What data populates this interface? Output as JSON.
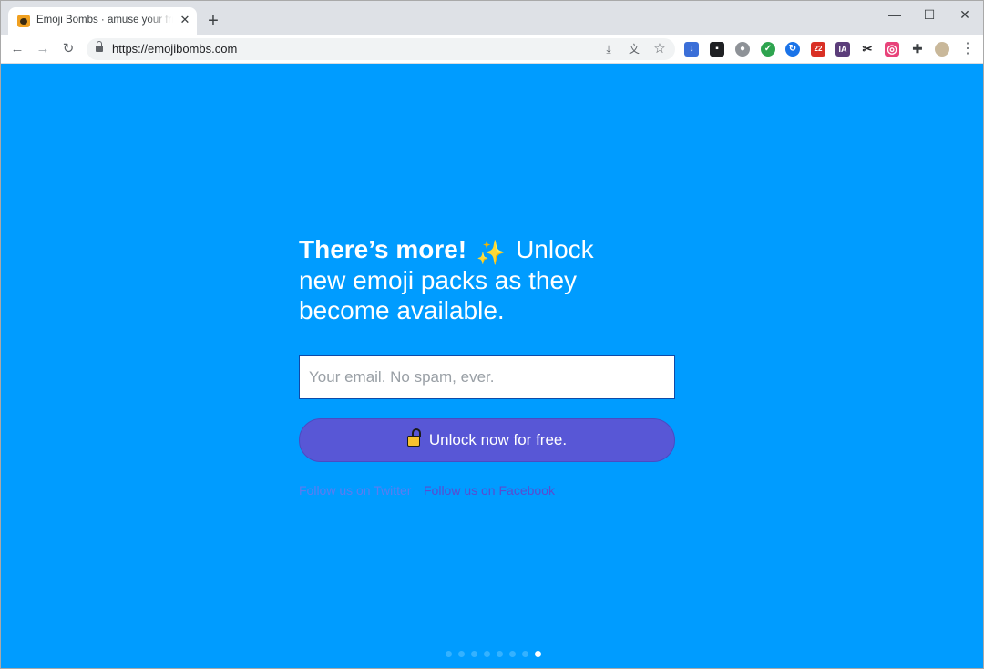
{
  "browser": {
    "tab": {
      "title": "Emoji Bombs · amuse your friends",
      "close": "✕"
    },
    "new_tab": "+",
    "window_controls": {
      "minimize": "—",
      "maximize": "☐",
      "close": "✕"
    },
    "nav": {
      "back": "←",
      "forward": "→",
      "reload": "↻"
    },
    "url": "https://emojibombs.com",
    "omnibox_icons": {
      "install": "⤓",
      "translate": "文",
      "bookmark": "☆"
    },
    "extensions": [
      {
        "name": "download-extension-icon",
        "color": "#3b6fd8",
        "glyph": "↓"
      },
      {
        "name": "tabs-extension-icon",
        "color": "#202124",
        "glyph": "▪"
      },
      {
        "name": "cookie-extension-icon",
        "color": "#8e9297",
        "glyph": "●"
      },
      {
        "name": "check-extension-icon",
        "color": "#2ea44f",
        "glyph": "✓"
      },
      {
        "name": "refresh-extension-icon",
        "color": "#1a73e8",
        "glyph": "↻"
      },
      {
        "name": "notification-extension-icon",
        "color": "#d93025",
        "glyph": "22"
      },
      {
        "name": "ia-extension-icon",
        "color": "#5b3d7a",
        "glyph": "IA"
      },
      {
        "name": "scissors-extension-icon",
        "color": "#ffffff",
        "glyph": "✂"
      },
      {
        "name": "target-extension-icon",
        "color": "#e8437a",
        "glyph": "◎"
      },
      {
        "name": "puzzle-extension-icon",
        "color": "#ffffff",
        "glyph": "✚"
      }
    ],
    "menu": "⋮"
  },
  "page": {
    "headline_bold": "There’s more!",
    "sparkle": "✨",
    "headline_rest": "Unlock new emoji packs as they become available.",
    "email_placeholder": "Your email. No spam, ever.",
    "unlock_button": "Unlock now for free.",
    "follow_twitter": "Follow us on Twitter",
    "follow_facebook": "Follow us on Facebook",
    "pagination": {
      "total": 8,
      "active_index": 7
    },
    "colors": {
      "background": "#009cff",
      "button": "#5857d6",
      "dot": "#35b2ff",
      "dot_active": "#ffffff"
    }
  }
}
